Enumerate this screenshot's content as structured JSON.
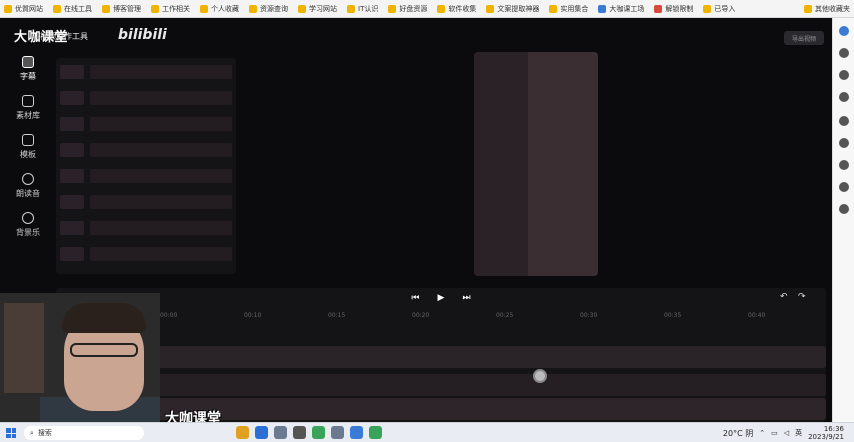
{
  "bookmarks": {
    "items": [
      {
        "label": "优質网站",
        "color": "#f0b400"
      },
      {
        "label": "在线工具",
        "color": "#f0b400"
      },
      {
        "label": "博客管理",
        "color": "#f0b400"
      },
      {
        "label": "工作相关",
        "color": "#f0b400"
      },
      {
        "label": "个人收藏",
        "color": "#f0b400"
      },
      {
        "label": "资源查询",
        "color": "#f0b400"
      },
      {
        "label": "学习网站",
        "color": "#f0b400"
      },
      {
        "label": "IT认识",
        "color": "#f0b400"
      },
      {
        "label": "好盘资源",
        "color": "#f0b400"
      },
      {
        "label": "软件收集",
        "color": "#f0b400"
      },
      {
        "label": "文案提取神器",
        "color": "#f0b400"
      },
      {
        "label": "实用集合",
        "color": "#f0b400"
      },
      {
        "label": "大咖课工场",
        "color": "#3a7bd5"
      },
      {
        "label": "解锁限制",
        "color": "#d54a3a"
      },
      {
        "label": "已导入",
        "color": "#f0b400"
      }
    ],
    "other": "其他收藏夹"
  },
  "app": {
    "brand": "大咖课堂",
    "title": "视频剪作工具",
    "bili": "bilibili",
    "export_label": "导出视频"
  },
  "sidebar": {
    "items": [
      {
        "label": "字幕",
        "icon": "subtitle-icon",
        "active": true
      },
      {
        "label": "素材库",
        "icon": "library-icon",
        "active": false
      },
      {
        "label": "模板",
        "icon": "template-icon",
        "active": false
      },
      {
        "label": "朗读音",
        "icon": "voice-icon",
        "active": false
      },
      {
        "label": "背景乐",
        "icon": "music-icon",
        "active": false
      }
    ]
  },
  "timeline": {
    "ticks": [
      "00:00",
      "00:10",
      "00:15",
      "00:20",
      "00:25",
      "00:30",
      "00:35",
      "00:40"
    ],
    "controls": {
      "prev": "⏮",
      "play": "▶",
      "next": "⏭",
      "undo": "↶",
      "redo": "↷"
    }
  },
  "watermark": "大咖课堂",
  "taskbar": {
    "search_placeholder": "搜索",
    "weather": "20°C 阴",
    "lang": "英",
    "time": "16:36",
    "date": "2023/9/21"
  }
}
